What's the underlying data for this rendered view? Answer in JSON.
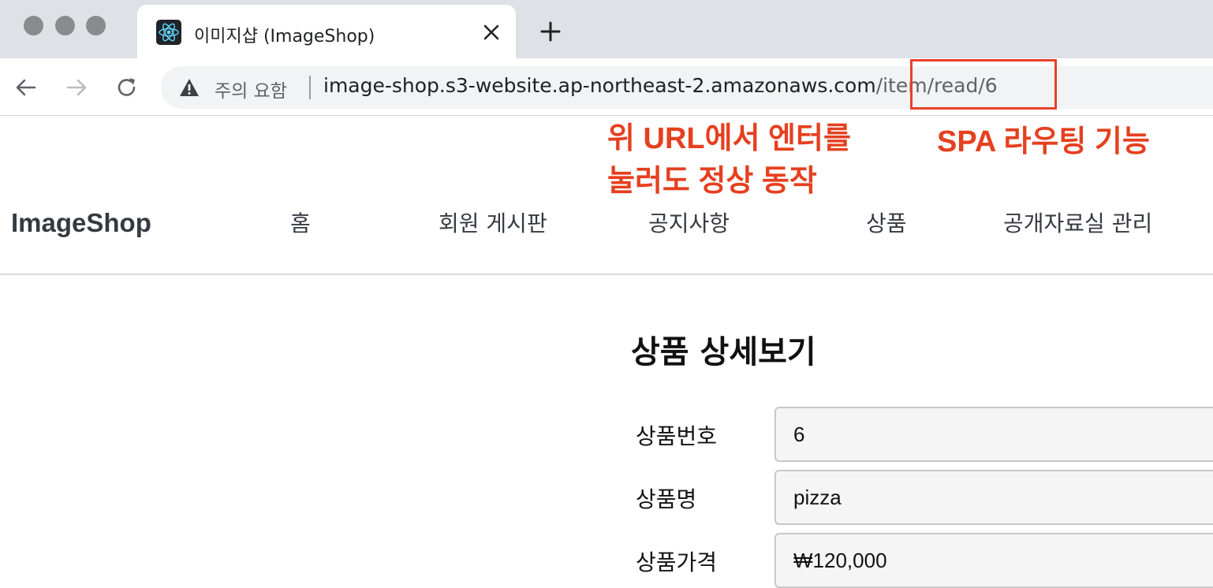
{
  "browser": {
    "tab_title": "이미지샵 (ImageShop)",
    "new_tab_glyph": "+",
    "close_glyph": "✕",
    "security_label": "주의 요함",
    "url_host": "image-shop.s3-website.ap-northeast-2.amazonaws.com",
    "url_path": "/item/read/6",
    "icons": [
      "back-arrow-icon",
      "forward-arrow-icon",
      "reload-icon",
      "warning-icon",
      "react-icon"
    ]
  },
  "annotations": {
    "line1": "위 URL에서 엔터를",
    "line2": "눌러도 정상 동작",
    "spa": "SPA 라우팅 기능",
    "color": "#e5401f"
  },
  "navbar": {
    "brand": "ImageShop",
    "items": [
      {
        "label": "홈"
      },
      {
        "label": "회원 게시판"
      },
      {
        "label": "공지사항"
      },
      {
        "label": "상품"
      },
      {
        "label": "공개자료실 관리"
      }
    ]
  },
  "main": {
    "heading": "상품 상세보기",
    "fields": [
      {
        "label": "상품번호",
        "value": "6"
      },
      {
        "label": "상품명",
        "value": "pizza"
      },
      {
        "label": "상품가격",
        "value": "₩120,000"
      }
    ]
  }
}
